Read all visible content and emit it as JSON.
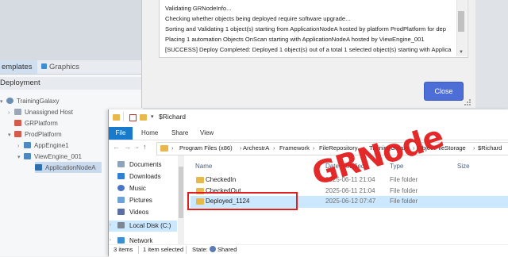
{
  "ide": {
    "tabs": [
      {
        "label": "emplates"
      },
      {
        "label": "Graphics"
      }
    ],
    "panel_title": "Deployment",
    "tree": [
      {
        "label": "TrainingGalaxy"
      },
      {
        "label": "Unassigned Host"
      },
      {
        "label": "GRPlatform"
      },
      {
        "label": "ProdPlatform"
      },
      {
        "label": "AppEngine1"
      },
      {
        "label": "ViewEngine_001"
      },
      {
        "label": "ApplicationNodeA"
      }
    ]
  },
  "dialog": {
    "log_lines": [
      "Validating GRNodeInfo...",
      "Checking whether objects being deployed require software upgrade...",
      "Sorting and Validating 1 object(s) starting from ApplicationNodeA hosted by platform ProdPlatform for dep",
      "Placing 1 automation Objects OnScan starting with ApplicationNodeA hosted by ViewEngine_001",
      "[SUCCESS] Deploy Completed: Deployed 1 object(s) out of a total 1 selected object(s) starting with Applica"
    ],
    "close_label": "Close"
  },
  "explorer": {
    "title": "$Richard",
    "ribbon_tabs": [
      "File",
      "Home",
      "Share",
      "View"
    ],
    "breadcrumb": [
      "Program Files (x86)",
      "ArchestrA",
      "Framework",
      "FileRepository",
      "TrainingGalaxy",
      "ObjectFileStorage",
      "$Richard"
    ],
    "nav_items": [
      {
        "label": "Documents",
        "icon": "documents-icon"
      },
      {
        "label": "Downloads",
        "icon": "downloads-icon"
      },
      {
        "label": "Music",
        "icon": "music-icon"
      },
      {
        "label": "Pictures",
        "icon": "pictures-icon"
      },
      {
        "label": "Videos",
        "icon": "videos-icon"
      },
      {
        "label": "Local Disk (C:)",
        "icon": "local-disk-icon"
      },
      {
        "label": "Network",
        "icon": "network-icon"
      }
    ],
    "columns": {
      "name": "Name",
      "date": "Date modified",
      "type": "Type",
      "size": "Size"
    },
    "files": [
      {
        "name": "CheckedIn",
        "date": "2025-06-11 21:04",
        "type": "File folder"
      },
      {
        "name": "CheckedOut",
        "date": "2025-06-11 21:04",
        "type": "File folder"
      },
      {
        "name": "Deployed_1124",
        "date": "2025-06-12 07:47",
        "type": "File folder"
      }
    ],
    "status": {
      "items": "3 items",
      "selected": "1 item selected",
      "state_label": "State:",
      "state_value": "Shared"
    }
  },
  "annotation": {
    "text": "GRNode",
    "color": "#e21e1e"
  },
  "colors": {
    "accent": "#1979ca",
    "close_button": "#4c6ed6",
    "selection": "#cce8ff"
  }
}
